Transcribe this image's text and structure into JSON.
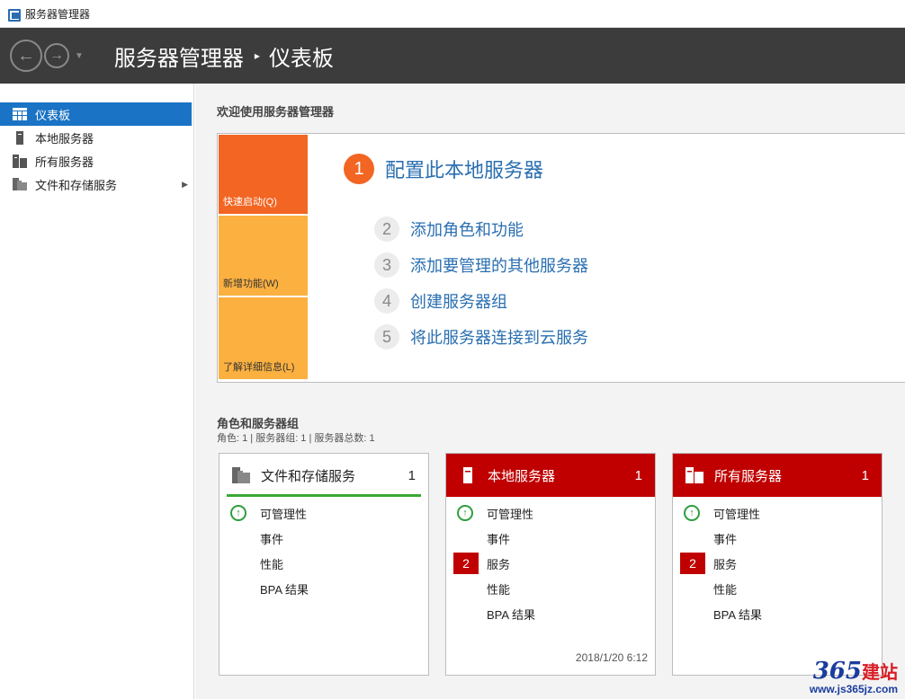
{
  "window": {
    "title": "服务器管理器",
    "icon": "server-manager-icon"
  },
  "header": {
    "back_icon": "back-arrow-icon",
    "forward_icon": "forward-arrow-icon",
    "dropdown_icon": "dropdown-caret-icon",
    "app_name": "服务器管理器",
    "separator": "▸",
    "page": "仪表板"
  },
  "sidebar": {
    "items": [
      {
        "label": "仪表板",
        "icon": "dashboard-grid-icon",
        "active": true
      },
      {
        "label": "本地服务器",
        "icon": "local-server-icon"
      },
      {
        "label": "所有服务器",
        "icon": "all-servers-icon"
      },
      {
        "label": "文件和存储服务",
        "icon": "file-storage-icon",
        "has_submenu": true
      }
    ]
  },
  "welcome": {
    "title": "欢迎使用服务器管理器",
    "tiles": [
      "快速启动(Q)",
      "新增功能(W)",
      "了解详细信息(L)"
    ],
    "main_step": {
      "num": "1",
      "label": "配置此本地服务器"
    },
    "steps": [
      {
        "num": "2",
        "label": "添加角色和功能"
      },
      {
        "num": "3",
        "label": "添加要管理的其他服务器"
      },
      {
        "num": "4",
        "label": "创建服务器组"
      },
      {
        "num": "5",
        "label": "将此服务器连接到云服务"
      }
    ]
  },
  "roles": {
    "title": "角色和服务器组",
    "subtitle": "角色: 1 | 服务器组: 1 | 服务器总数: 1",
    "cards": [
      {
        "name": "文件和存储服务",
        "count": "1",
        "icon": "file-storage-icon",
        "status": "ok",
        "rows": [
          "可管理性",
          "事件",
          "性能",
          "BPA 结果"
        ]
      },
      {
        "name": "本地服务器",
        "count": "1",
        "icon": "local-server-icon",
        "status": "alert",
        "rows": [
          "可管理性",
          "事件",
          "服务",
          "性能",
          "BPA 结果"
        ],
        "service_badge": "2",
        "timestamp": "2018/1/20 6:12"
      },
      {
        "name": "所有服务器",
        "count": "1",
        "icon": "all-servers-icon",
        "status": "alert",
        "rows": [
          "可管理性",
          "事件",
          "服务",
          "性能",
          "BPA 结果"
        ],
        "service_badge": "2"
      }
    ]
  },
  "watermark": {
    "logo": "365",
    "suffix": "建站",
    "url": "www.js365jz.com"
  },
  "colors": {
    "accent_blue": "#1a73c4",
    "orange": "#f26522",
    "amber": "#fbb040",
    "alert_red": "#c00000",
    "ok_green": "#2e9e3e",
    "header_bg": "#3c3c3c"
  }
}
